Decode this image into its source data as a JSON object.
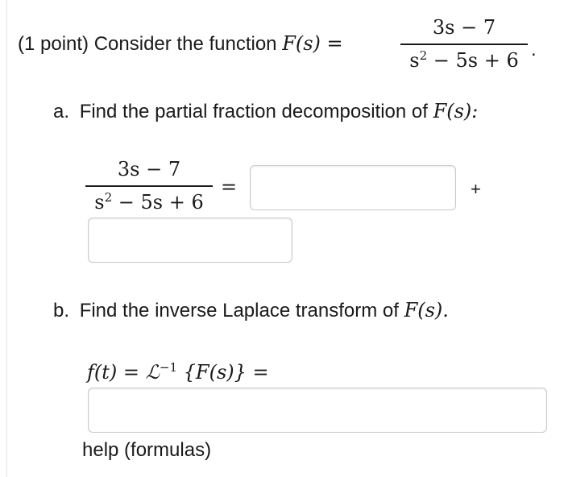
{
  "intro": {
    "points": "(1 point)",
    "prompt": "Consider the function",
    "func": "F(s) =",
    "numerator": "3s − 7",
    "denominator_base": "s",
    "denominator_exp": "2",
    "denominator_rest": " − 5s + 6",
    "period": "."
  },
  "part_a": {
    "marker": "a.",
    "text": "Find the partial fraction decomposition of",
    "func": "F(s):",
    "numerator": "3s − 7",
    "denominator_base": "s",
    "denominator_exp": "2",
    "denominator_rest": " − 5s + 6",
    "equals": "=",
    "plus": "+",
    "answer1_value": "",
    "answer2_value": ""
  },
  "part_b": {
    "marker": "b.",
    "text": "Find the inverse Laplace transform of",
    "func": "F(s).",
    "expr_lhs": "f(t) = ℒ",
    "expr_sup": "−1",
    "expr_rhs": " {F(s)} =",
    "answer_value": ""
  },
  "help_link": "help (formulas)"
}
